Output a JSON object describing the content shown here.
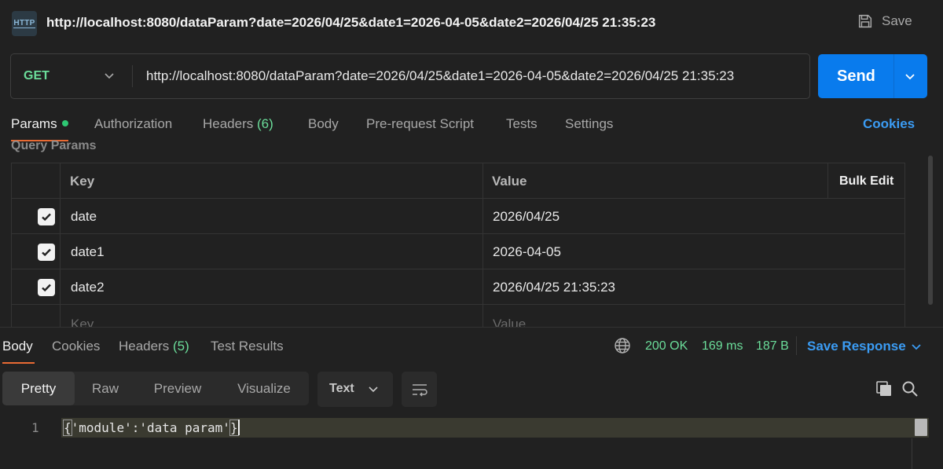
{
  "header": {
    "icon": "http-icon",
    "icon_text": "HTTP",
    "title": "http://localhost:8080/dataParam?date=2026/04/25&date1=2026-04-05&date2=2026/04/25 21:35:23",
    "save_label": "Save"
  },
  "request": {
    "method": "GET",
    "url": "http://localhost:8080/dataParam?date=2026/04/25&date1=2026-04-05&date2=2026/04/25 21:35:23",
    "send_label": "Send"
  },
  "request_tabs": {
    "params": "Params",
    "authorization": "Authorization",
    "headers": "Headers",
    "headers_count": "(6)",
    "body": "Body",
    "prerequest": "Pre-request Script",
    "tests": "Tests",
    "settings": "Settings",
    "cookies": "Cookies"
  },
  "query_params": {
    "section_title": "Query Params",
    "columns": {
      "key": "Key",
      "value": "Value",
      "bulk_edit": "Bulk Edit"
    },
    "rows": [
      {
        "checked": true,
        "key": "date",
        "value": "2026/04/25"
      },
      {
        "checked": true,
        "key": "date1",
        "value": "2026-04-05"
      },
      {
        "checked": true,
        "key": "date2",
        "value": "2026/04/25 21:35:23"
      }
    ],
    "new_row": {
      "key_placeholder": "Key",
      "value_placeholder": "Value"
    }
  },
  "response": {
    "tabs": {
      "body": "Body",
      "cookies": "Cookies",
      "headers": "Headers",
      "headers_count": "(5)",
      "test_results": "Test Results"
    },
    "status": "200 OK",
    "time": "169 ms",
    "size": "187 B",
    "save_response": "Save Response",
    "view_modes": [
      "Pretty",
      "Raw",
      "Preview",
      "Visualize"
    ],
    "active_view": "Pretty",
    "format": "Text",
    "lines": [
      {
        "number": "1",
        "open": "{",
        "content": "'module':'data param'",
        "close": "}"
      }
    ]
  },
  "colors": {
    "accent_blue": "#097bed",
    "method_green": "#6bdd9a",
    "tab_underline": "#e86a33",
    "link_blue": "#3b9cf4"
  }
}
